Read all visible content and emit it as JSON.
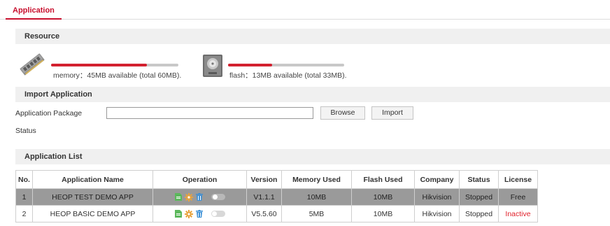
{
  "tabs": {
    "active": "Application"
  },
  "resource": {
    "title": "Resource",
    "memory": {
      "text": "memory：45MB available (total 60MB).",
      "used_fraction": 0.75
    },
    "flash": {
      "text": "flash：13MB available (total 33MB).",
      "used_fraction": 0.38
    }
  },
  "import": {
    "title": "Import Application",
    "package_label": "Application Package",
    "package_value": "",
    "browse_label": "Browse",
    "import_label": "Import",
    "status_label": "Status"
  },
  "app_list": {
    "title": "Application List",
    "headers": [
      "No.",
      "Application Name",
      "Operation",
      "Version",
      "Memory Used",
      "Flash Used",
      "Company",
      "Status",
      "License"
    ],
    "rows": [
      {
        "no": "1",
        "name": "HEOP TEST DEMO APP",
        "version": "V1.1.1",
        "memory": "10MB",
        "flash": "10MB",
        "company": "Hikvision",
        "status": "Stopped",
        "license": "Free",
        "selected": true
      },
      {
        "no": "2",
        "name": "HEOP BASIC DEMO APP",
        "version": "V5.5.60",
        "memory": "5MB",
        "flash": "10MB",
        "company": "Hikvision",
        "status": "Stopped",
        "license": "Inactive",
        "selected": false
      }
    ],
    "icons": [
      "document-icon",
      "gear-icon",
      "trash-icon",
      "toggle-switch"
    ],
    "colors": {
      "document": "#5cb85c",
      "gear": "#e8a33d",
      "trash": "#3a8fd6",
      "inactive": "#e0202a",
      "selected_row": "#9a9a9a"
    }
  },
  "accent_color": "#c8102e"
}
